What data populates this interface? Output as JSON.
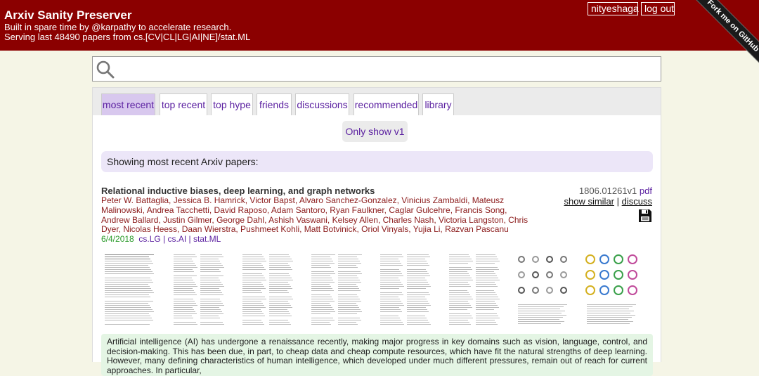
{
  "header": {
    "title": "Arxiv Sanity Preserver",
    "tagline": "Built in spare time by @karpathy to accelerate research.",
    "serving": "Serving last 48490 papers from cs.[CV|CL|LG|AI|NE]/stat.ML",
    "username": "nityeshaga",
    "logout_label": "log out",
    "ribbon_label": "Fork me on GitHub"
  },
  "search": {
    "value": "",
    "placeholder": ""
  },
  "tabs": [
    {
      "label": "most recent",
      "active": true
    },
    {
      "label": "top recent",
      "active": false
    },
    {
      "label": "top hype",
      "active": false
    },
    {
      "label": "friends",
      "active": false
    },
    {
      "label": "discussions",
      "active": false
    },
    {
      "label": "recommended",
      "active": false
    },
    {
      "label": "library",
      "active": false
    }
  ],
  "v1_button": "Only show v1",
  "banner": "Showing most recent Arxiv papers:",
  "paper": {
    "title": "Relational inductive biases, deep learning, and graph networks",
    "authors": "Peter W. Battaglia, Jessica B. Hamrick, Victor Bapst, Alvaro Sanchez-Gonzalez, Vinicius Zambaldi, Mateusz Malinowski, Andrea Tacchetti, David Raposo, Adam Santoro, Ryan Faulkner, Caglar Gulcehre, Francis Song, Andrew Ballard, Justin Gilmer, George Dahl, Ashish Vaswani, Kelsey Allen, Charles Nash, Victoria Langston, Chris Dyer, Nicolas Heess, Daan Wierstra, Pushmeet Kohli, Matt Botvinick, Oriol Vinyals, Yujia Li, Razvan Pascanu",
    "date": "6/4/2018",
    "categories": "cs.LG | cs.AI | stat.ML",
    "arxiv_id": "1806.01261v1",
    "pdf_label": "pdf",
    "show_similar_label": "show similar",
    "separator": "|",
    "discuss_label": "discuss",
    "save_icon": "floppy-disk-icon",
    "abstract": "Artificial intelligence (AI) has undergone a renaissance recently, making major progress in key domains such as vision, language, control, and decision-making. This has been due, in part, to cheap data and cheap compute resources, which have fit the natural strengths of deep learning. However, many defining characteristics of human intelligence, which developed under much different pressures, remain out of reach for current approaches. In particular,"
  },
  "colors": {
    "header_bg": "#8b0000",
    "page_bg": "#f5f5e6",
    "active_tab": "#d8c8ee",
    "link": "#5a1fa0",
    "authors": "#8b1a1a",
    "date": "#2a9a2a",
    "abstract_bg": "#e4f5e4"
  }
}
